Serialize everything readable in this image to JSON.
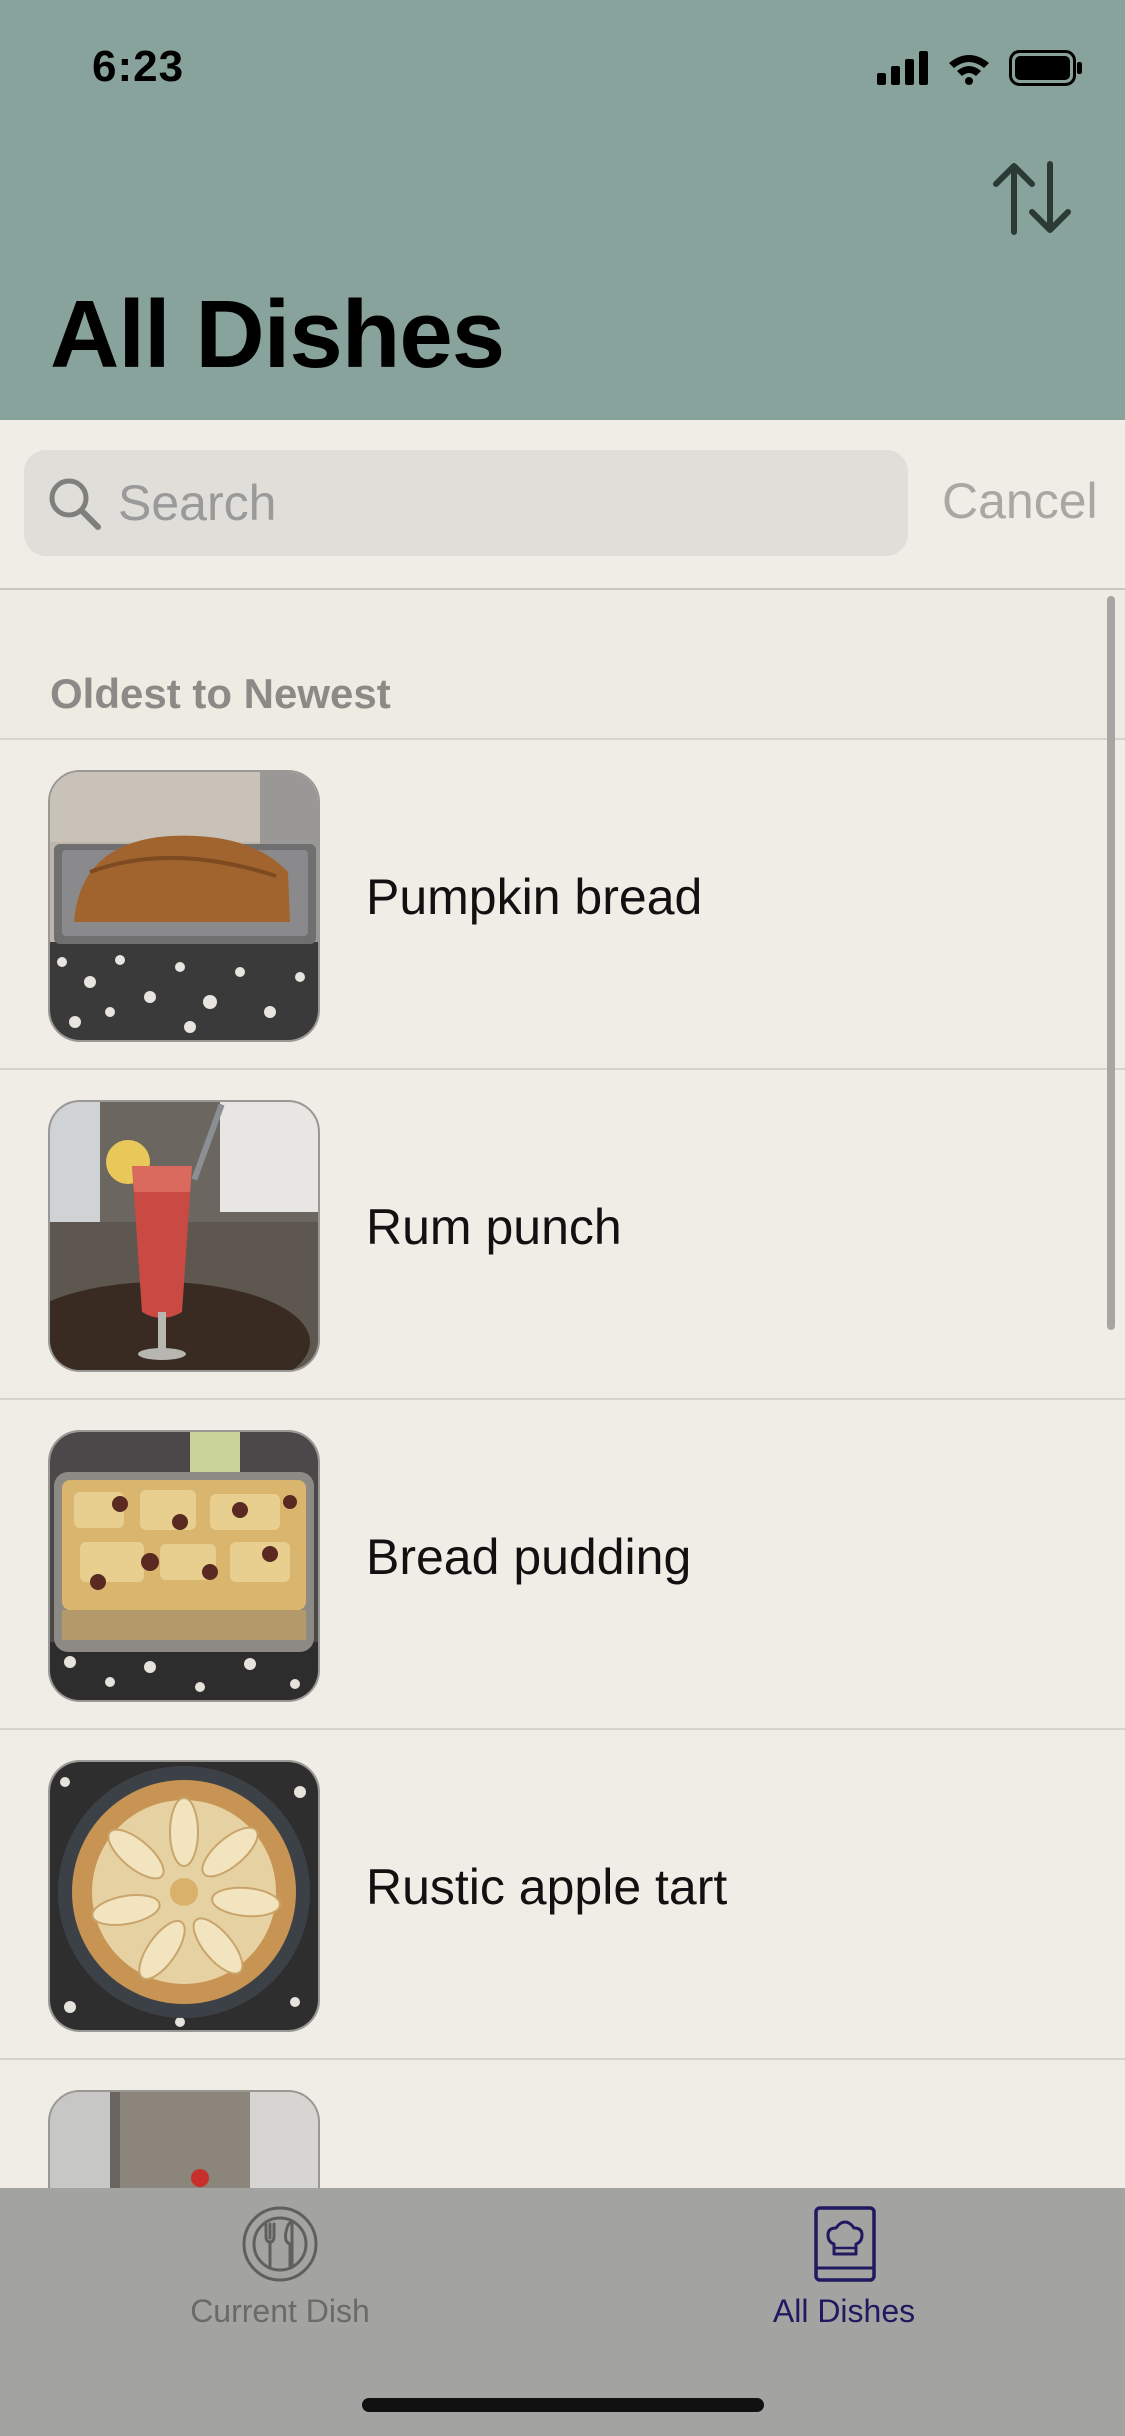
{
  "status_bar": {
    "time": "6:23"
  },
  "header": {
    "title": "All Dishes",
    "sort_icon": "sort-arrows-icon"
  },
  "search": {
    "placeholder": "Search",
    "cancel_label": "Cancel"
  },
  "section": {
    "label": "Oldest to Newest"
  },
  "dishes": [
    {
      "name": "Pumpkin bread"
    },
    {
      "name": "Rum punch"
    },
    {
      "name": "Bread pudding"
    },
    {
      "name": "Rustic apple tart"
    },
    {
      "name": ""
    }
  ],
  "tabbar": {
    "tabs": [
      {
        "label": "Current Dish",
        "icon": "plate-utensils-icon",
        "selected": false
      },
      {
        "label": "All Dishes",
        "icon": "recipe-book-icon",
        "selected": true
      }
    ]
  },
  "colors": {
    "header_bg": "#88a39b",
    "content_bg": "#f0ede7",
    "tabbar_bg": "#a3a4a1",
    "selected_tab": "#1f1960"
  }
}
